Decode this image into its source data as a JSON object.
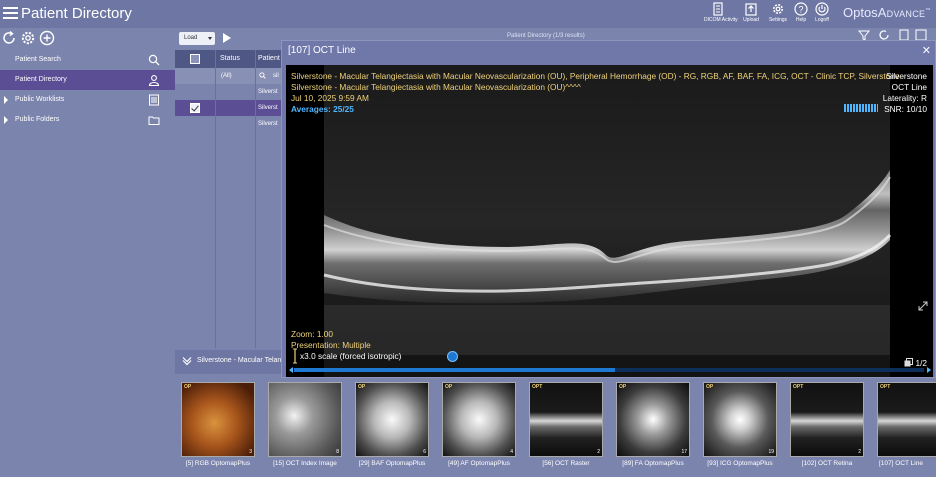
{
  "header": {
    "title": "Patient Directory",
    "actions": [
      {
        "label": "DICOM Activity",
        "icon": "dicom-activity-icon"
      },
      {
        "label": "Upload",
        "icon": "upload-icon"
      },
      {
        "label": "Settings",
        "icon": "gear-icon"
      },
      {
        "label": "Help",
        "icon": "help-icon"
      },
      {
        "label": "Logoff",
        "icon": "power-icon"
      }
    ],
    "brand_optos": "Optos",
    "brand_advance": "Advance",
    "brand_tm": "™"
  },
  "sidebar": {
    "items": [
      {
        "label": "Patient Search",
        "icon": "search-icon"
      },
      {
        "label": "Patient Directory",
        "icon": "user-icon"
      },
      {
        "label": "Public Worklists",
        "icon": "list-icon"
      },
      {
        "label": "Public Folders",
        "icon": "folder-icon"
      }
    ]
  },
  "grid": {
    "load_label": "Load",
    "columns": [
      "Status",
      "Patient"
    ],
    "status_filter": "(All)",
    "patient_filter": "sil",
    "rows": [
      "Silverst",
      "Silverst",
      "Silverst"
    ],
    "title_behind": "Patient Directory (1/3 results)"
  },
  "viewer": {
    "title": "[107] OCT Line",
    "diagnosis_line1": "Silverstone - Macular Telangiectasia with Macular Neovascularization (OU), Peripheral Hemorrhage (OD) - RG, RGB, AF, BAF, FA, ICG, OCT - Clinic TCP, Silverstone",
    "diagnosis_line2": "Silverstone - Macular Telangiectasia with Macular Neovascularization (OU)^^^^",
    "datetime": "Jul 10, 2025 9:59 AM",
    "averages": "Averages: 25/25",
    "device_label": "Silverstone",
    "type_label": "OCT Line",
    "laterality": "Laterality: R",
    "snr": "SNR: 10/10",
    "zoom": "Zoom: 1.00",
    "presentation": "Presentation: Multiple",
    "scale_note": "x3.0 scale (forced isotropic)",
    "frame_counter": "1/2",
    "scroll_progress": 0.51
  },
  "filmstrip": {
    "header": "Silverstone - Macular Telan",
    "thumbs": [
      {
        "tag": "OP",
        "num": "3",
        "label": "[5] RGB OptomapPlus",
        "kind": "rgb"
      },
      {
        "tag": "",
        "num": "8",
        "label": "[15] OCT Index Image",
        "kind": "gray"
      },
      {
        "tag": "OP",
        "num": "6",
        "label": "[29] BAF OptomapPlus",
        "kind": "baf"
      },
      {
        "tag": "OP",
        "num": "4",
        "label": "[49] AF OptomapPlus",
        "kind": "baf"
      },
      {
        "tag": "OPT",
        "num": "2",
        "label": "[56] OCT Raster",
        "kind": "oct"
      },
      {
        "tag": "OP",
        "num": "17",
        "label": "[89] FA OptomapPlus",
        "kind": "fa"
      },
      {
        "tag": "OP",
        "num": "19",
        "label": "[93] ICG OptomapPlus",
        "kind": "icg"
      },
      {
        "tag": "OPT",
        "num": "2",
        "label": "[102] OCT Retina",
        "kind": "oct"
      },
      {
        "tag": "OPT",
        "num": "",
        "label": "[107] OCT Line",
        "kind": "oct"
      }
    ]
  },
  "colors": {
    "background": "#7b84ad",
    "selected": "#5b4e95",
    "accent_blue": "#4fb7ff",
    "overlay_yellow": "#f0d27a"
  }
}
